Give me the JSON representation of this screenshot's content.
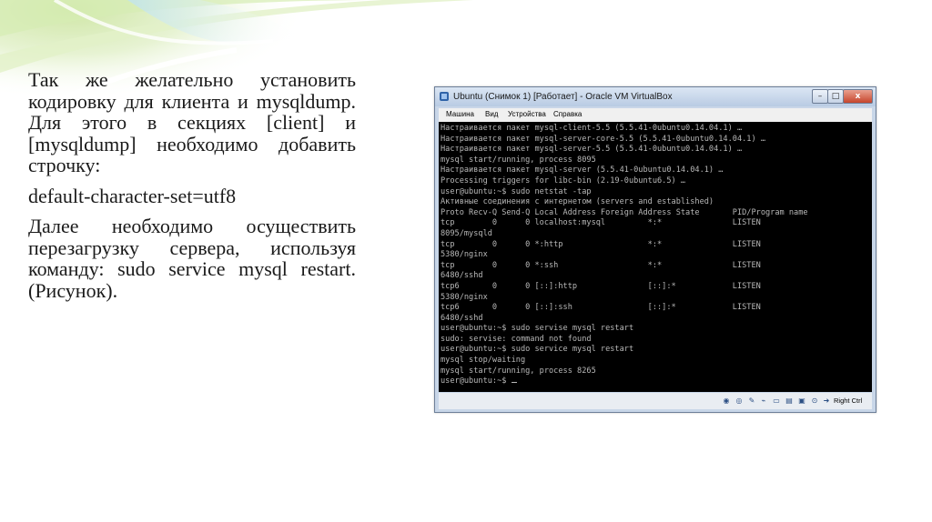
{
  "slide": {
    "paragraph1": "Так же желательно установить кодировку для клиента и mysqldump. Для этого в секциях [client] и [mysqldump] необходимо добавить строчку:",
    "paragraph2": "default-character-set=utf8",
    "paragraph3": "Далее необходимо осуществить перезагрузку сервера, используя команду: sudo service mysql restart. (Рисунок)."
  },
  "window": {
    "title": "Ubuntu (Снимок 1) [Работает] - Oracle VM VirtualBox",
    "minimize_label": "–",
    "maximize_label": "□",
    "close_label": "x"
  },
  "menu": {
    "items": [
      "Машина",
      "Вид",
      "Устройства",
      "Справка"
    ]
  },
  "terminal": {
    "lines": [
      "Настраивается пакет mysql-client-5.5 (5.5.41-0ubuntu0.14.04.1) …",
      "Настраивается пакет mysql-server-core-5.5 (5.5.41-0ubuntu0.14.04.1) …",
      "Настраивается пакет mysql-server-5.5 (5.5.41-0ubuntu0.14.04.1) …",
      "mysql start/running, process 8095",
      "Настраивается пакет mysql-server (5.5.41-0ubuntu0.14.04.1) …",
      "Processing triggers for libc-bin (2.19-0ubuntu6.5) …",
      "user@ubuntu:~$ sudo netstat -tap",
      "Активные соединения с интернетом (servers and established)",
      "Proto Recv-Q Send-Q Local Address Foreign Address State       PID/Program name",
      "tcp        0      0 localhost:mysql         *:*               LISTEN",
      "8095/mysqld",
      "tcp        0      0 *:http                  *:*               LISTEN",
      "5380/nginx",
      "tcp        0      0 *:ssh                   *:*               LISTEN",
      "6480/sshd",
      "tcp6       0      0 [::]:http               [::]:*            LISTEN",
      "5380/nginx",
      "tcp6       0      0 [::]:ssh                [::]:*            LISTEN",
      "6480/sshd",
      "user@ubuntu:~$ sudo servise mysql restart",
      "sudo: servise: command not found",
      "user@ubuntu:~$ sudo service mysql restart",
      "mysql stop/waiting",
      "mysql start/running, process 8265",
      "user@ubuntu:~$ "
    ]
  },
  "status": {
    "host_key": "Right Ctrl"
  },
  "colors": {
    "terminal_bg": "#000000",
    "terminal_fg": "#b8b8b8",
    "window_frame": "#c8d6e8",
    "close_button": "#c6452c"
  }
}
